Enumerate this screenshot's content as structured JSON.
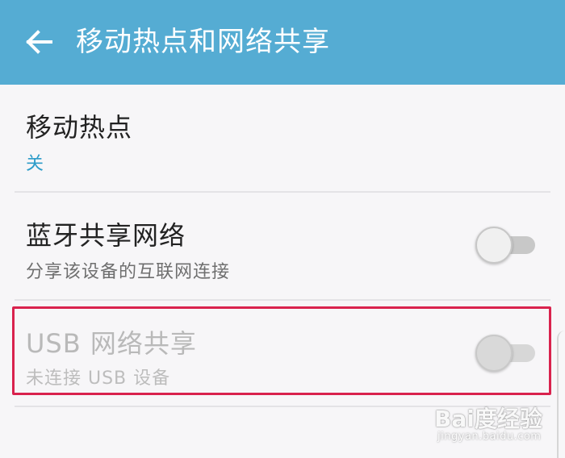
{
  "appbar": {
    "back_icon": "arrow-left-icon",
    "title": "移动热点和网络共享",
    "background": "#55acd3"
  },
  "rows": [
    {
      "title": "移动热点",
      "subtitle": "关"
    },
    {
      "title": "蓝牙共享网络",
      "subtitle": "分享该设备的互联网连接",
      "toggle": "off"
    },
    {
      "title": "USB 网络共享",
      "subtitle": "未连接 USB 设备",
      "toggle": "off",
      "enabled": false
    }
  ],
  "colors": {
    "accent": "#2d9cc9",
    "highlight_border": "#d9224d"
  },
  "watermark": {
    "main": "Bai度经验",
    "sub": "jingyan.baidu.com"
  }
}
